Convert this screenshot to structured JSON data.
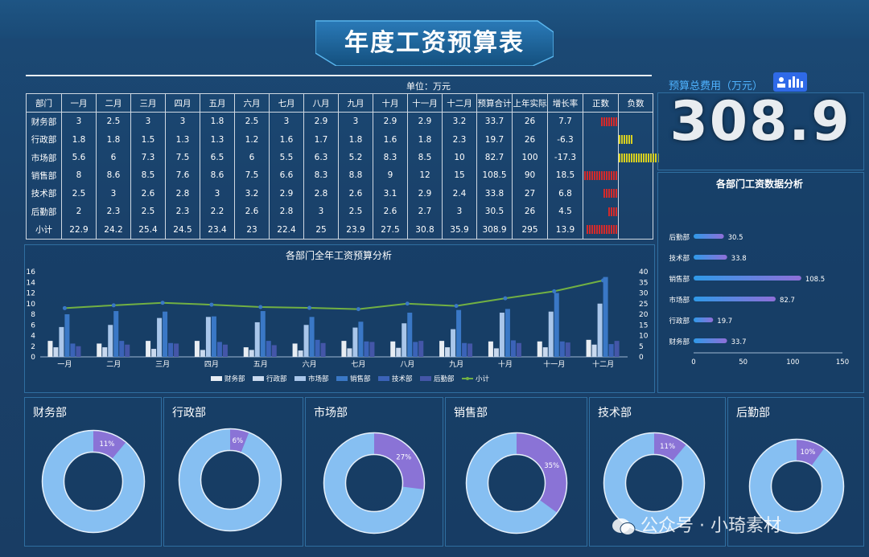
{
  "title": "年度工资预算表",
  "unit_label": "单位：万元",
  "table": {
    "headers": [
      "部门",
      "一月",
      "二月",
      "三月",
      "四月",
      "五月",
      "六月",
      "七月",
      "八月",
      "九月",
      "十月",
      "十一月",
      "十二月",
      "预算合计",
      "上年实际",
      "增长率",
      "正数",
      "负数"
    ],
    "rows": [
      {
        "dept": "财务部",
        "months": [
          "3",
          "2.5",
          "3",
          "3",
          "1.8",
          "2.5",
          "3",
          "2.9",
          "3",
          "2.9",
          "2.9",
          "3.2"
        ],
        "total": "33.7",
        "last_year": "26",
        "growth": "7.7",
        "pos_ticks": 7,
        "neg_ticks": 0
      },
      {
        "dept": "行政部",
        "months": [
          "1.8",
          "1.8",
          "1.5",
          "1.3",
          "1.3",
          "1.2",
          "1.6",
          "1.7",
          "1.8",
          "1.6",
          "1.8",
          "2.3"
        ],
        "total": "19.7",
        "last_year": "26",
        "growth": "-6.3",
        "pos_ticks": 0,
        "neg_ticks": 6
      },
      {
        "dept": "市场部",
        "months": [
          "5.6",
          "6",
          "7.3",
          "7.5",
          "6.5",
          "6",
          "5.5",
          "6.3",
          "5.2",
          "8.3",
          "8.5",
          "10"
        ],
        "total": "82.7",
        "last_year": "100",
        "growth": "-17.3",
        "pos_ticks": 0,
        "neg_ticks": 17
      },
      {
        "dept": "销售部",
        "months": [
          "8",
          "8.6",
          "8.5",
          "7.6",
          "8.6",
          "7.5",
          "6.6",
          "8.3",
          "8.8",
          "9",
          "12",
          "15"
        ],
        "total": "108.5",
        "last_year": "90",
        "growth": "18.5",
        "pos_ticks": 14,
        "neg_ticks": 0
      },
      {
        "dept": "技术部",
        "months": [
          "2.5",
          "3",
          "2.6",
          "2.8",
          "3",
          "3.2",
          "2.9",
          "2.8",
          "2.6",
          "3.1",
          "2.9",
          "2.4"
        ],
        "total": "33.8",
        "last_year": "27",
        "growth": "6.8",
        "pos_ticks": 6,
        "neg_ticks": 0
      },
      {
        "dept": "后勤部",
        "months": [
          "2",
          "2.3",
          "2.5",
          "2.3",
          "2.2",
          "2.6",
          "2.8",
          "3",
          "2.5",
          "2.6",
          "2.7",
          "3"
        ],
        "total": "30.5",
        "last_year": "26",
        "growth": "4.5",
        "pos_ticks": 4,
        "neg_ticks": 0
      },
      {
        "dept": "小计",
        "months": [
          "22.9",
          "24.2",
          "25.4",
          "24.5",
          "23.4",
          "23",
          "22.4",
          "25",
          "23.9",
          "27.5",
          "30.8",
          "35.9"
        ],
        "total": "308.9",
        "last_year": "295",
        "growth": "13.9",
        "pos_ticks": 13,
        "neg_ticks": 0
      }
    ]
  },
  "total": {
    "label": "预算总费用（万元）",
    "value": "308.9",
    "icon": "bar-chart-icon"
  },
  "colors": {
    "pos": "#d42a2a",
    "neg": "#d8d020",
    "line": "#72b043"
  },
  "chart_data": [
    {
      "type": "bar",
      "title": "各部门全年工资预算分析",
      "categories": [
        "一月",
        "二月",
        "三月",
        "四月",
        "五月",
        "六月",
        "七月",
        "八月",
        "九月",
        "十月",
        "十一月",
        "十二月"
      ],
      "series": [
        {
          "name": "财务部",
          "values": [
            3,
            2.5,
            3,
            3,
            1.8,
            2.5,
            3,
            2.9,
            3,
            2.9,
            2.9,
            3.2
          ],
          "color": "#e8edf3"
        },
        {
          "name": "行政部",
          "values": [
            1.8,
            1.8,
            1.5,
            1.3,
            1.3,
            1.2,
            1.6,
            1.7,
            1.8,
            1.6,
            1.8,
            2.3
          ],
          "color": "#c9d9ee"
        },
        {
          "name": "市场部",
          "values": [
            5.6,
            6,
            7.3,
            7.5,
            6.5,
            6,
            5.5,
            6.3,
            5.2,
            8.3,
            8.5,
            10
          ],
          "color": "#a9c6ea"
        },
        {
          "name": "销售部",
          "values": [
            8,
            8.6,
            8.5,
            7.6,
            8.6,
            7.5,
            6.6,
            8.3,
            8.8,
            9,
            12,
            15
          ],
          "color": "#3a78c6"
        },
        {
          "name": "技术部",
          "values": [
            2.5,
            3,
            2.6,
            2.8,
            3,
            3.2,
            2.9,
            2.8,
            2.6,
            3.1,
            2.9,
            2.4
          ],
          "color": "#3b63b8"
        },
        {
          "name": "后勤部",
          "values": [
            2,
            2.3,
            2.5,
            2.3,
            2.2,
            2.6,
            2.8,
            3,
            2.5,
            2.6,
            2.7,
            3
          ],
          "color": "#4456a8"
        },
        {
          "name": "小计",
          "type": "line",
          "values": [
            22.9,
            24.2,
            25.4,
            24.5,
            23.4,
            23,
            22.4,
            25,
            23.9,
            27.5,
            30.8,
            35.9
          ],
          "color": "#72b043"
        }
      ],
      "ylim": [
        0,
        16
      ],
      "y_ticks": [
        "0",
        "2",
        "4",
        "6",
        "8",
        "10",
        "12",
        "14",
        "16"
      ],
      "y2lim": [
        0,
        40
      ],
      "y2_ticks": [
        "0",
        "5",
        "10",
        "15",
        "20",
        "25",
        "30",
        "35",
        "40"
      ],
      "legend": "bottom"
    },
    {
      "type": "bar",
      "orientation": "horizontal",
      "title": "各部门工资数据分析",
      "categories": [
        "后勤部",
        "技术部",
        "销售部",
        "市场部",
        "行政部",
        "财务部"
      ],
      "values": [
        30.5,
        33.8,
        108.5,
        82.7,
        19.7,
        33.7
      ],
      "value_labels": [
        "30.5",
        "33.8",
        "108.5",
        "82.7",
        "19.7",
        "33.7"
      ],
      "xlim": [
        0,
        150
      ],
      "x_ticks": [
        "0",
        "50",
        "100",
        "150"
      ]
    },
    {
      "type": "pie",
      "charts": [
        {
          "title": "财务部",
          "share": 11,
          "label": "11%"
        },
        {
          "title": "行政部",
          "share": 6,
          "label": "6%"
        },
        {
          "title": "市场部",
          "share": 27,
          "label": "27%"
        },
        {
          "title": "销售部",
          "share": 35,
          "label": "35%"
        },
        {
          "title": "技术部",
          "share": 11,
          "label": "11%"
        },
        {
          "title": "后勤部",
          "share": 10,
          "label": "10%"
        }
      ],
      "colors": {
        "share": "#8a73d6",
        "rest": "#86bff2"
      }
    }
  ],
  "watermark": "公众号 · 小琦素材"
}
